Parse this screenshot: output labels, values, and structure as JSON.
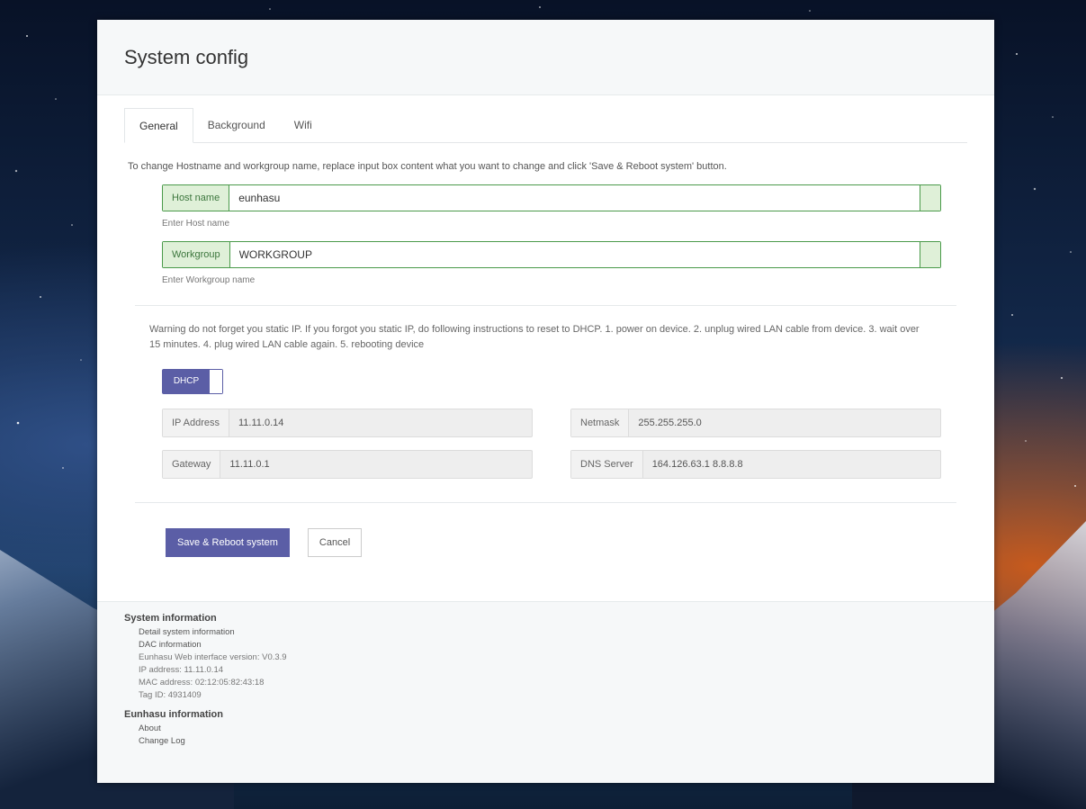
{
  "header": {
    "title": "System config"
  },
  "tabs": [
    {
      "label": "General",
      "active": true
    },
    {
      "label": "Background",
      "active": false
    },
    {
      "label": "Wifi",
      "active": false
    }
  ],
  "general": {
    "info_text": "To change Hostname and workgroup name, replace input box content what you want to change and click 'Save & Reboot system' button.",
    "hostname": {
      "label": "Host name",
      "value": "eunhasu",
      "help": "Enter Host name"
    },
    "workgroup": {
      "label": "Workgroup",
      "value": "WORKGROUP",
      "help": "Enter Workgroup name"
    },
    "warning_text": "Warning do not forget you static IP. If you forgot you static IP, do following instructions to reset to DHCP. 1. power on device. 2. unplug wired LAN cable from device. 3. wait over 15 minutes. 4. plug wired LAN cable again. 5. rebooting device",
    "dhcp_toggle": {
      "label": "DHCP",
      "on": true
    },
    "network": {
      "ip": {
        "label": "IP Address",
        "value": "11.11.0.14"
      },
      "netmask": {
        "label": "Netmask",
        "value": "255.255.255.0"
      },
      "gateway": {
        "label": "Gateway",
        "value": "11.11.0.1"
      },
      "dns": {
        "label": "DNS Server",
        "value": "164.126.63.1 8.8.8.8"
      }
    },
    "buttons": {
      "save": "Save & Reboot system",
      "cancel": "Cancel"
    }
  },
  "footer": {
    "system_info": {
      "title": "System information",
      "detail": "Detail system information",
      "dac": "DAC information",
      "version": "Eunhasu Web interface version: V0.3.9",
      "ip": "IP address: 11.11.0.14",
      "mac": "MAC address: 02:12:05:82:43:18",
      "tag": "Tag ID: 4931409"
    },
    "eunhasu_info": {
      "title": "Eunhasu information",
      "about": "About",
      "changelog": "Change Log"
    }
  },
  "colors": {
    "accent": "#5b5ea6",
    "success_border": "#4a9a4a",
    "success_bg": "#dff0d8",
    "success_text": "#3c763d"
  }
}
